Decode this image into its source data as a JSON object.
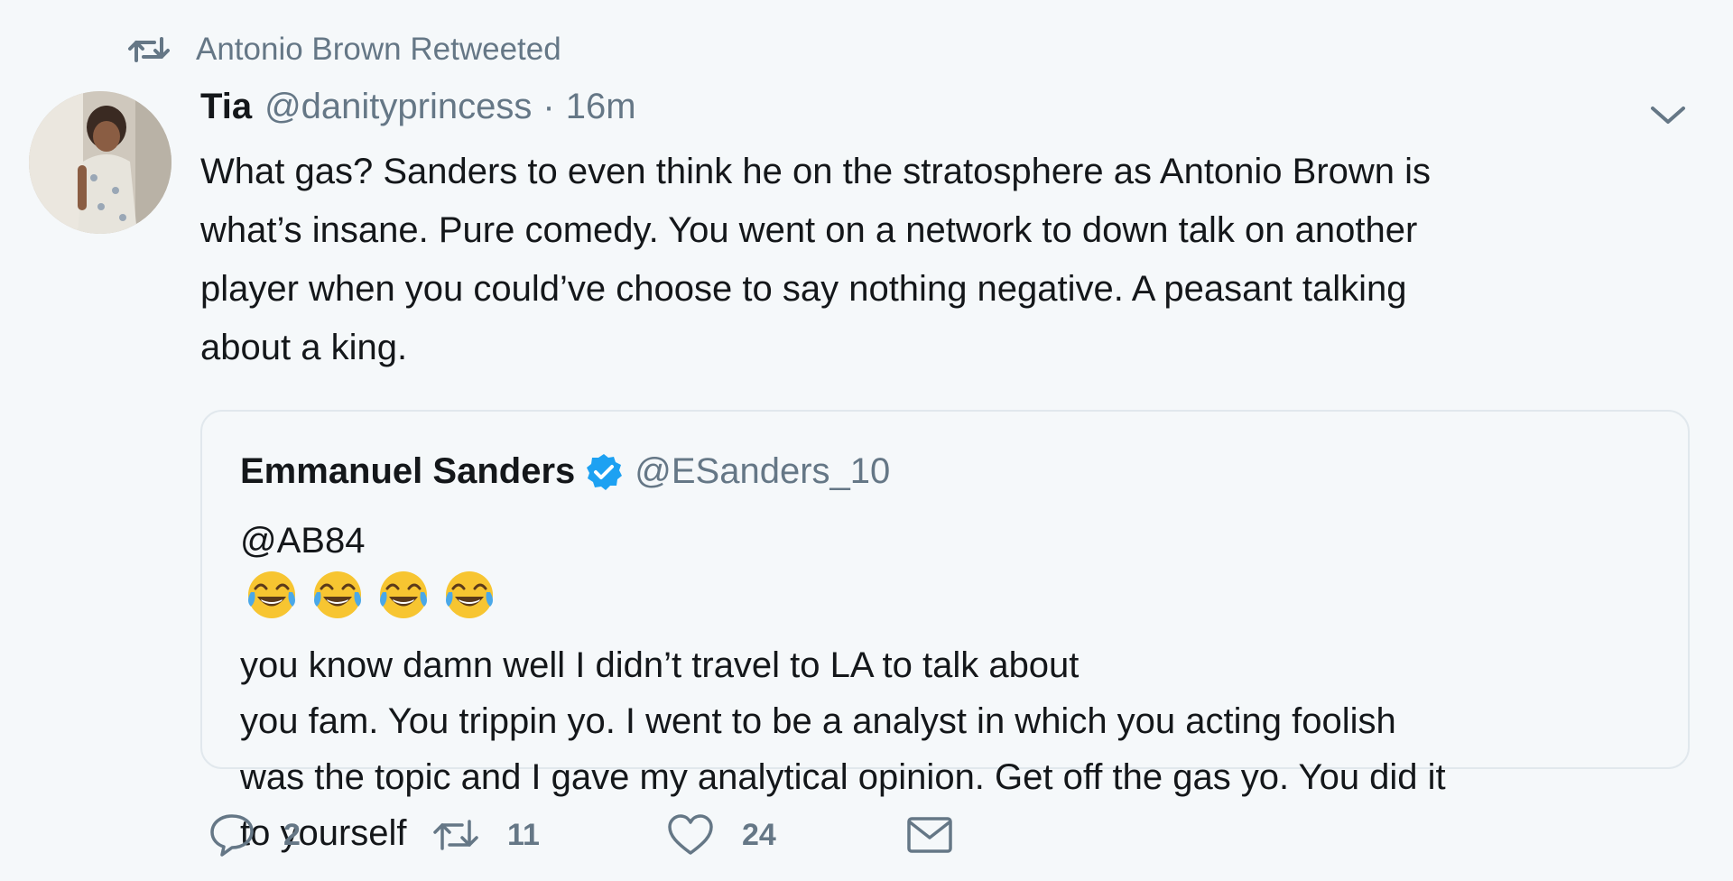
{
  "retweet_context": {
    "icon": "retweet-icon",
    "text": "Antonio Brown Retweeted"
  },
  "tweet": {
    "author": {
      "name": "Tia",
      "handle": "@danityprincess",
      "avatar": "profile-photo"
    },
    "separator": "·",
    "time": "16m",
    "menu_icon": "chevron-down-icon",
    "text_lines": [
      "What gas? Sanders to even think he on the stratosphere as Antonio Brown is",
      "what’s insane. Pure comedy. You went on a network to down talk on another",
      "player when you could’ve choose to say nothing negative. A peasant talking",
      "about a king."
    ]
  },
  "quoted_tweet": {
    "author": {
      "name": "Emmanuel Sanders",
      "verified_icon": "verified-badge-icon",
      "handle": "@ESanders_10"
    },
    "mention": "@AB84",
    "emojis": [
      "face-with-tears-of-joy",
      "face-with-tears-of-joy",
      "face-with-tears-of-joy",
      "face-with-tears-of-joy"
    ],
    "text_line1_rest": "you know damn well I didn’t travel to LA to talk about",
    "text_lines": [
      "you fam. You trippin yo. I went to be a analyst in which you acting foolish",
      "was the topic and I gave my analytical opinion. Get off the gas yo. You did it",
      "to yourself"
    ]
  },
  "actions": {
    "reply": {
      "icon": "reply-icon",
      "count": "2"
    },
    "retweet": {
      "icon": "retweet-icon",
      "count": "11"
    },
    "like": {
      "icon": "heart-icon",
      "count": "24"
    },
    "message": {
      "icon": "envelope-icon"
    }
  },
  "colors": {
    "background": "#f5f8fa",
    "text": "#14171a",
    "secondary_text": "#657786",
    "verified": "#1da1f2",
    "border": "#e1e8ed"
  }
}
